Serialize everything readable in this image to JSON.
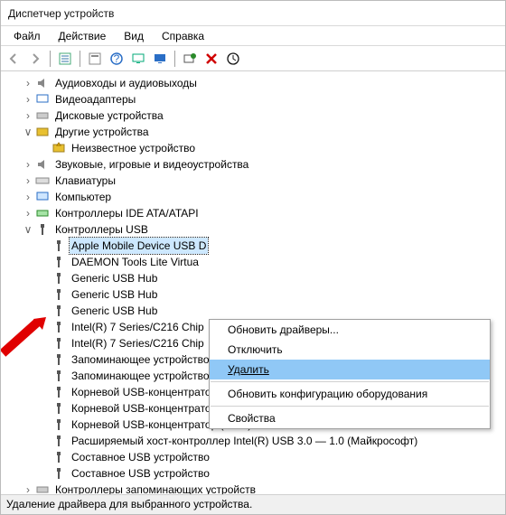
{
  "title": "Диспетчер устройств",
  "menu": {
    "file": "Файл",
    "action": "Действие",
    "view": "Вид",
    "help": "Справка"
  },
  "icons": {
    "back": "back-icon",
    "fwd": "forward-icon",
    "view": "view-icon",
    "props": "props-icon",
    "help": "help-icon",
    "mon1": "monitor-icon",
    "mon2": "monitor-blue-icon",
    "add": "add-hw-icon",
    "del": "delete-icon",
    "up": "update-icon"
  },
  "tree": {
    "audio": "Аудиовходы и аудиовыходы",
    "video": "Видеоадаптеры",
    "disk": "Дисковые устройства",
    "other": "Другие устройства",
    "unknown": "Неизвестное устройство",
    "sound": "Звуковые, игровые и видеоустройства",
    "keyboard": "Клавиатуры",
    "computer": "Компьютер",
    "ide": "Контроллеры IDE ATA/ATAPI",
    "usb": "Контроллеры USB",
    "u0": "Apple Mobile Device USB D",
    "u1": "DAEMON Tools Lite Virtua",
    "u2": "Generic USB Hub",
    "u3": "Generic USB Hub",
    "u4": "Generic USB Hub",
    "u5": "Intel(R) 7 Series/C216 Chip",
    "u6": "Intel(R) 7 Series/C216 Chip",
    "u7": "Запоминающее устройство для USB",
    "u8": "Запоминающее устройство для USB",
    "u9": "Корневой USB-концентратор",
    "u10": "Корневой USB-концентратор",
    "u11": "Корневой USB-концентратор (xHCI)",
    "u12": "Расширяемый хост-контроллер Intel(R) USB 3.0 — 1.0 (Майкрософт)",
    "u13": "Составное USB устройство",
    "u14": "Составное USB устройство",
    "storctrl": "Контроллеры запоминающих устройств"
  },
  "ctx": {
    "update": "Обновить драйверы...",
    "disable": "Отключить",
    "delete": "Удалить",
    "scan": "Обновить конфигурацию оборудования",
    "props": "Свойства"
  },
  "status": "Удаление драйвера для выбранного устройства."
}
